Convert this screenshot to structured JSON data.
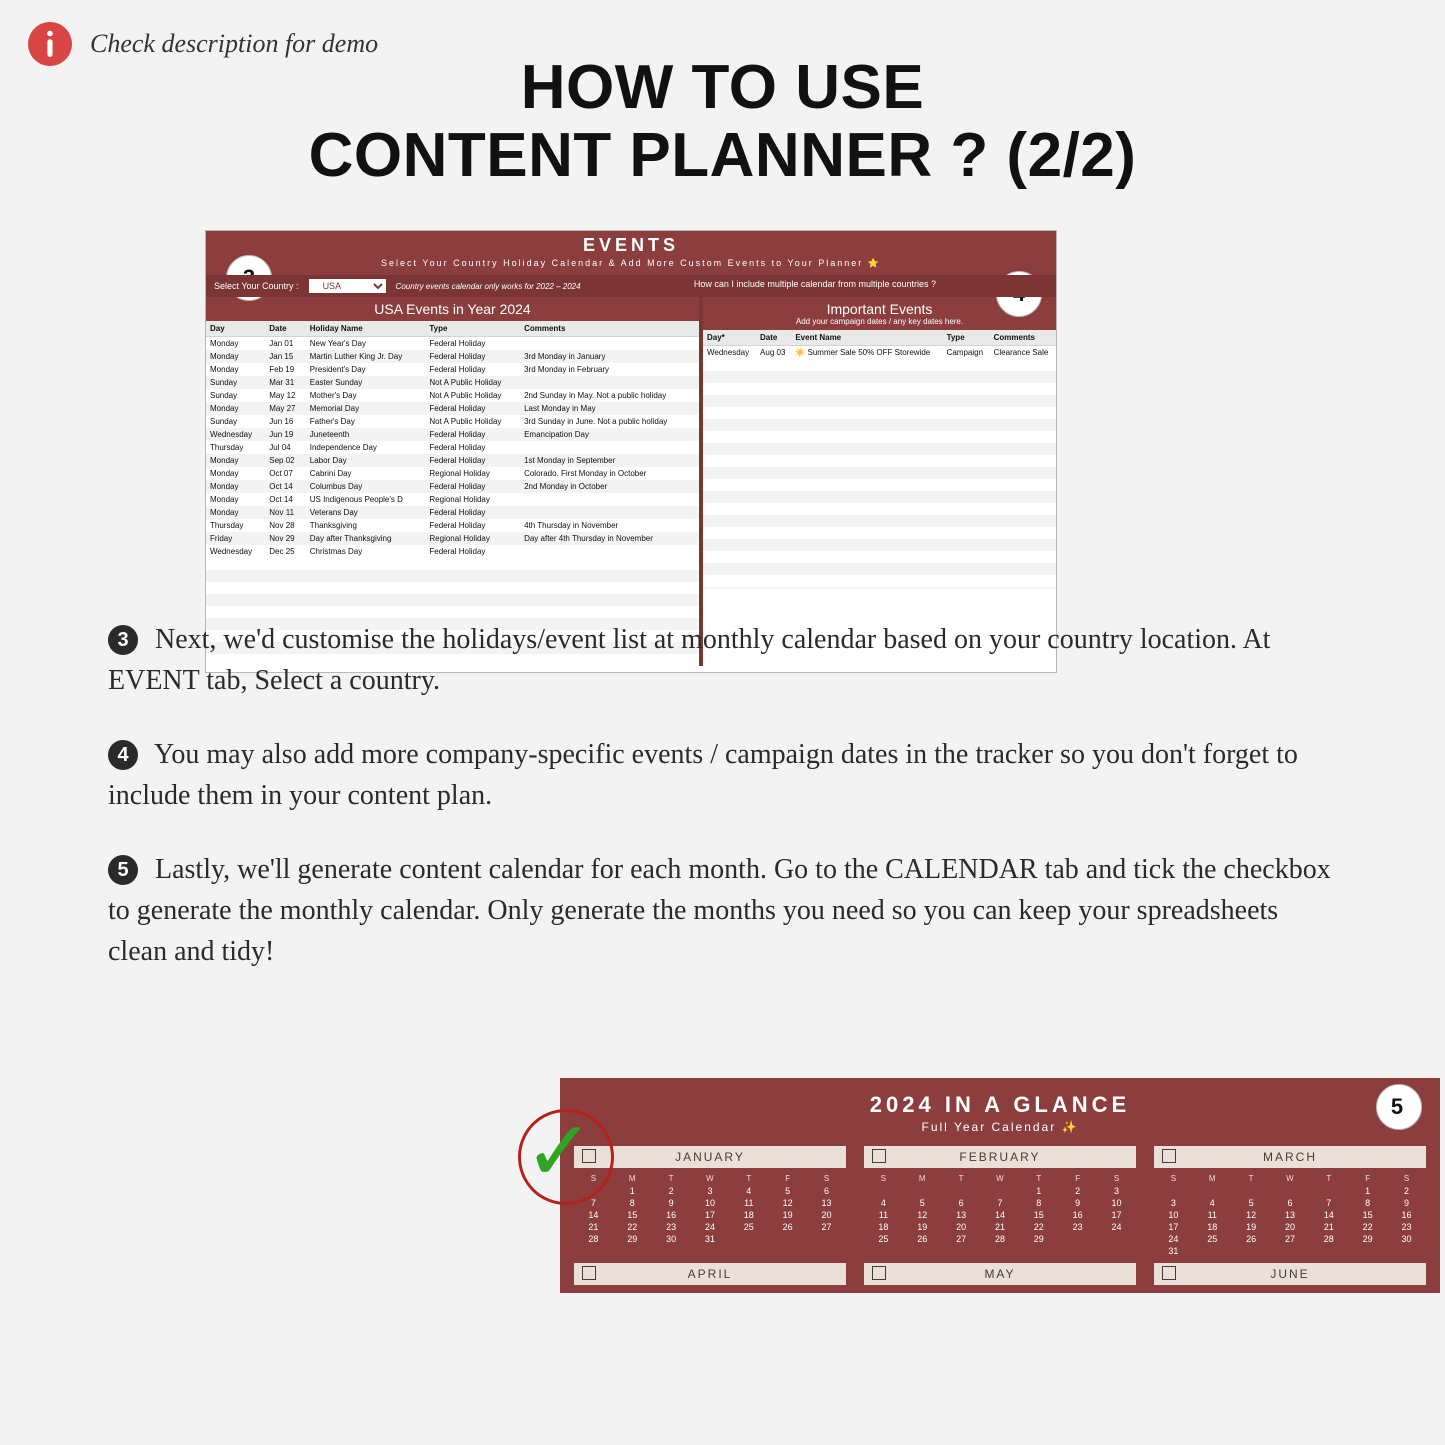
{
  "info_text": "Check description for demo",
  "title_line1": "HOW TO USE",
  "title_line2": "CONTENT PLANNER ? (2/2)",
  "shot1": {
    "header": "EVENTS",
    "subheader": "Select Your Country Holiday Calendar & Add More Custom Events to Your Planner ⭐",
    "toolbar": {
      "label": "Select Your Country :",
      "value": "USA",
      "note": "Country events calendar only works for 2022 – 2024",
      "question": "How can I include multiple calendar from multiple countries ?"
    },
    "left": {
      "title": "USA Events in Year 2024",
      "columns": [
        "Day",
        "Date",
        "Holiday Name",
        "Type",
        "Comments"
      ],
      "rows": [
        [
          "Monday",
          "Jan 01",
          "New Year's Day",
          "Federal Holiday",
          ""
        ],
        [
          "Monday",
          "Jan 15",
          "Martin Luther King Jr. Day",
          "Federal Holiday",
          "3rd Monday in January"
        ],
        [
          "Monday",
          "Feb 19",
          "President's Day",
          "Federal Holiday",
          "3rd Monday in February"
        ],
        [
          "Sunday",
          "Mar 31",
          "Easter Sunday",
          "Not A Public Holiday",
          ""
        ],
        [
          "Sunday",
          "May 12",
          "Mother's Day",
          "Not A Public Holiday",
          "2nd Sunday in May. Not a public holiday"
        ],
        [
          "Monday",
          "May 27",
          "Memorial Day",
          "Federal Holiday",
          "Last Monday in May"
        ],
        [
          "Sunday",
          "Jun 16",
          "Father's Day",
          "Not A Public Holiday",
          "3rd Sunday in June. Not a public holiday"
        ],
        [
          "Wednesday",
          "Jun 19",
          "Juneteenth",
          "Federal Holiday",
          "Emancipation Day"
        ],
        [
          "Thursday",
          "Jul 04",
          "Independence Day",
          "Federal Holiday",
          ""
        ],
        [
          "Monday",
          "Sep 02",
          "Labor Day",
          "Federal Holiday",
          "1st Monday in September"
        ],
        [
          "Monday",
          "Oct 07",
          "Cabrini Day",
          "Regional Holiday",
          "Colorado. First Monday in October"
        ],
        [
          "Monday",
          "Oct 14",
          "Columbus Day",
          "Federal Holiday",
          "2nd Monday in October"
        ],
        [
          "Monday",
          "Oct 14",
          "US Indigenous People's D",
          "Regional Holiday",
          ""
        ],
        [
          "Monday",
          "Nov 11",
          "Veterans Day",
          "Federal Holiday",
          ""
        ],
        [
          "Thursday",
          "Nov 28",
          "Thanksgiving",
          "Federal Holiday",
          "4th Thursday in November"
        ],
        [
          "Friday",
          "Nov 29",
          "Day after Thanksgiving",
          "Regional Holiday",
          "Day after 4th Thursday in November"
        ],
        [
          "Wednesday",
          "Dec 25",
          "Christmas Day",
          "Federal Holiday",
          ""
        ]
      ]
    },
    "right": {
      "title": "Important Events",
      "subtitle": "Add your campaign dates / any key dates here.",
      "columns": [
        "Day*",
        "Date",
        "Event Name",
        "Type",
        "Comments"
      ],
      "rows": [
        [
          "Wednesday",
          "Aug 03",
          "☀️ Summer Sale 50% OFF Storewide",
          "Campaign",
          "Clearance Sale"
        ]
      ]
    },
    "badge3": "3",
    "badge4": "4"
  },
  "steps": {
    "n3": "3",
    "t3": " Next, we'd customise the holidays/event list at monthly calendar based on your country location. At EVENT tab, Select a country.",
    "n4": "4",
    "t4": " You may also add more company-specific events / campaign dates in the tracker so you don't forget to include them in your content plan.",
    "n5": "5",
    "t5": " Lastly, we'll generate content calendar for each month. Go to the CALENDAR tab and tick the checkbox to generate the monthly calendar. Only generate the months you need so you can keep your spreadsheets clean and tidy!"
  },
  "shot2": {
    "title": "2024 IN A GLANCE",
    "subtitle": "Full Year Calendar ✨",
    "badge5": "5",
    "months_row1": [
      "JANUARY",
      "FEBRUARY",
      "MARCH"
    ],
    "months_row2": [
      "APRIL",
      "MAY",
      "JUNE"
    ],
    "weekday_heads": [
      "S",
      "M",
      "T",
      "W",
      "T",
      "F",
      "S"
    ],
    "jan": [
      [
        "",
        "1",
        "2",
        "3",
        "4",
        "5",
        "6"
      ],
      [
        "7",
        "8",
        "9",
        "10",
        "11",
        "12",
        "13"
      ],
      [
        "14",
        "15",
        "16",
        "17",
        "18",
        "19",
        "20"
      ],
      [
        "21",
        "22",
        "23",
        "24",
        "25",
        "26",
        "27"
      ],
      [
        "28",
        "29",
        "30",
        "31",
        "",
        "",
        ""
      ]
    ],
    "feb": [
      [
        "",
        "",
        "",
        "",
        "1",
        "2",
        "3"
      ],
      [
        "4",
        "5",
        "6",
        "7",
        "8",
        "9",
        "10"
      ],
      [
        "11",
        "12",
        "13",
        "14",
        "15",
        "16",
        "17"
      ],
      [
        "18",
        "19",
        "20",
        "21",
        "22",
        "23",
        "24"
      ],
      [
        "25",
        "26",
        "27",
        "28",
        "29",
        "",
        ""
      ]
    ],
    "mar": [
      [
        "",
        "",
        "",
        "",
        "",
        "1",
        "2"
      ],
      [
        "3",
        "4",
        "5",
        "6",
        "7",
        "8",
        "9"
      ],
      [
        "10",
        "11",
        "12",
        "13",
        "14",
        "15",
        "16"
      ],
      [
        "17",
        "18",
        "19",
        "20",
        "21",
        "22",
        "23"
      ],
      [
        "24",
        "25",
        "26",
        "27",
        "28",
        "29",
        "30"
      ],
      [
        "31",
        "",
        "",
        "",
        "",
        "",
        ""
      ]
    ]
  }
}
